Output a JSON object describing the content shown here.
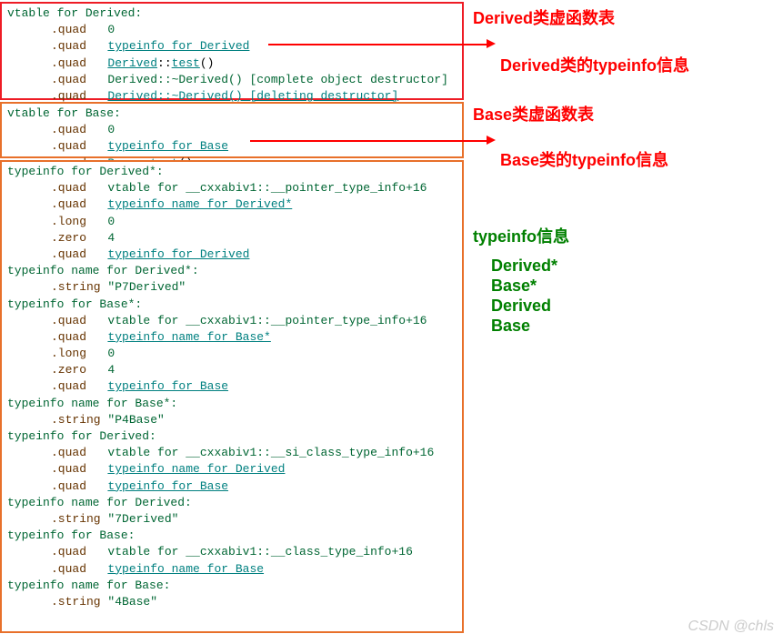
{
  "box1": {
    "l1": "vtable for Derived:",
    "l2a": ".quad   ",
    "l2b": "0",
    "l3a": ".quad   ",
    "l3b": "typeinfo for Derived",
    "l4a": ".quad   ",
    "l4b": "Derived",
    "l4c": "::",
    "l4d": "test",
    "l4e": "()",
    "l5a": ".quad   ",
    "l5b": "Derived::~Derived() [complete object destructor]",
    "l6a": ".quad   ",
    "l6b": "Derived::~Derived() [deleting destructor]"
  },
  "box2": {
    "l1": "vtable for Base:",
    "l2a": ".quad   ",
    "l2b": "0",
    "l3a": ".quad   ",
    "l3b": "typeinfo for Base",
    "l4a": ".quad   ",
    "l4b": "Base",
    "l4c": "::",
    "l4d": "test",
    "l4e": "()"
  },
  "box3": {
    "l1": "typeinfo for Derived*:",
    "l2a": ".quad   ",
    "l2b": "vtable for __cxxabiv1::__pointer_type_info+16",
    "l3a": ".quad   ",
    "l3b": "typeinfo name for Derived*",
    "l4a": ".long   ",
    "l4b": "0",
    "l5a": ".zero   ",
    "l5b": "4",
    "l6a": ".quad   ",
    "l6b": "typeinfo for Derived",
    "l7": "typeinfo name for Derived*:",
    "l8a": ".string ",
    "l8b": "\"P7Derived\"",
    "l9": "typeinfo for Base*:",
    "l10a": ".quad   ",
    "l10b": "vtable for __cxxabiv1::__pointer_type_info+16",
    "l11a": ".quad   ",
    "l11b": "typeinfo name for Base*",
    "l12a": ".long   ",
    "l12b": "0",
    "l13a": ".zero   ",
    "l13b": "4",
    "l14a": ".quad   ",
    "l14b": "typeinfo for Base",
    "l15": "typeinfo name for Base*:",
    "l16a": ".string ",
    "l16b": "\"P4Base\"",
    "l17": "typeinfo for Derived:",
    "l18a": ".quad   ",
    "l18b": "vtable for __cxxabiv1::__si_class_type_info+16",
    "l19a": ".quad   ",
    "l19b": "typeinfo name for Derived",
    "l20a": ".quad   ",
    "l20b": "typeinfo for Base",
    "l21": "typeinfo name for Derived:",
    "l22a": ".string ",
    "l22b": "\"7Derived\"",
    "l23": "typeinfo for Base:",
    "l24a": ".quad   ",
    "l24b": "vtable for __cxxabiv1::__class_type_info+16",
    "l25a": ".quad   ",
    "l25b": "typeinfo name for Base",
    "l26": "typeinfo name for Base:",
    "l27a": ".string ",
    "l27b": "\"4Base\""
  },
  "annotations": {
    "a1": "Derived类虚函数表",
    "a2": "Derived类的typeinfo信息",
    "a3": "Base类虚函数表",
    "a4": "Base类的typeinfo信息",
    "a5": "typeinfo信息",
    "a6": "Derived*",
    "a7": "Base*",
    "a8": "Derived",
    "a9": "Base"
  },
  "watermark": "CSDN @chls"
}
